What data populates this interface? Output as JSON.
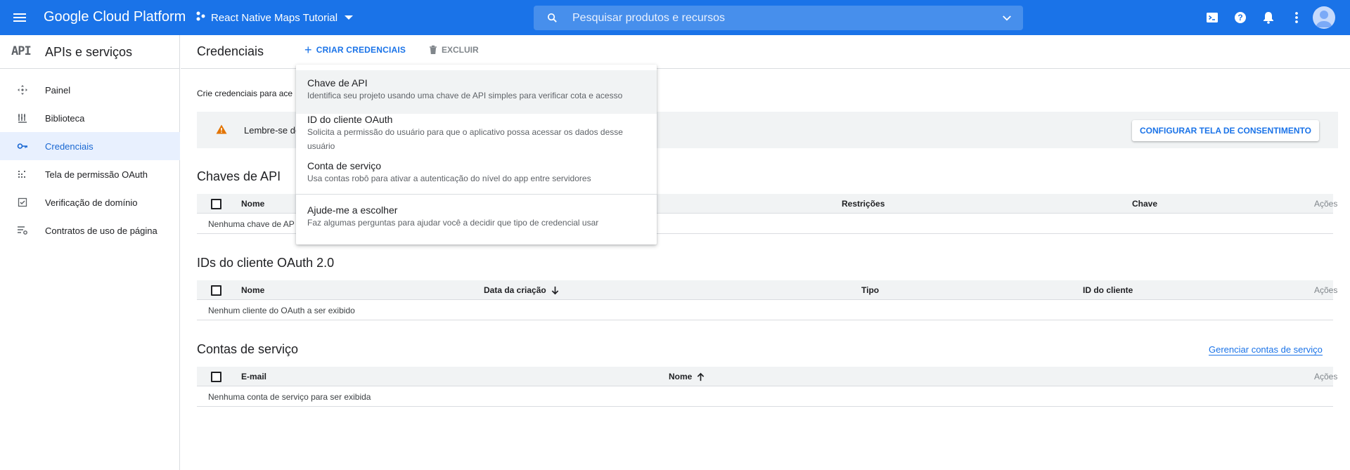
{
  "topbar": {
    "brand": "Google Cloud Platform",
    "project": "React Native Maps Tutorial",
    "search_placeholder": "Pesquisar produtos e recursos",
    "icons": [
      "menu-icon",
      "project-icon",
      "search-icon",
      "chevron-down-icon",
      "cloud-shell-icon",
      "help-icon",
      "notifications-icon",
      "more-vert-icon",
      "avatar"
    ]
  },
  "sidebar": {
    "logo": "API",
    "title": "APIs e serviços",
    "items": [
      {
        "label": "Painel",
        "icon": "dashboard-icon",
        "active": false
      },
      {
        "label": "Biblioteca",
        "icon": "library-icon",
        "active": false
      },
      {
        "label": "Credenciais",
        "icon": "key-icon",
        "active": true
      },
      {
        "label": "Tela de permissão OAuth",
        "icon": "consent-icon",
        "active": false
      },
      {
        "label": "Verificação de domínio",
        "icon": "domain-check-icon",
        "active": false
      },
      {
        "label": "Contratos de uso de página",
        "icon": "page-settings-icon",
        "active": false
      }
    ]
  },
  "header": {
    "title": "Credenciais",
    "create_label": "CRIAR CREDENCIAIS",
    "delete_label": "EXCLUIR"
  },
  "intro_text": "Crie credenciais para ace",
  "banner": {
    "text": "Lembre-se de",
    "button_label": "CONFIGURAR TELA DE CONSENTIMENTO"
  },
  "api_keys": {
    "title": "Chaves de API",
    "columns": [
      "Nome",
      "Restrições",
      "Chave",
      "Ações"
    ],
    "empty": "Nenhuma chave de AP"
  },
  "oauth": {
    "title": "IDs do cliente OAuth 2.0",
    "columns": [
      "Nome",
      "Data da criação",
      "Tipo",
      "ID do cliente",
      "Ações"
    ],
    "empty": "Nenhum cliente do OAuth a ser exibido"
  },
  "service_accounts": {
    "title": "Contas de serviço",
    "manage_link": "Gerenciar contas de serviço",
    "columns": [
      "E-mail",
      "Nome",
      "Ações"
    ],
    "empty": "Nenhuma conta de serviço para ser exibida"
  },
  "menu": {
    "items": [
      {
        "title": "Chave de API",
        "desc": "Identifica seu projeto usando uma chave de API simples para verificar cota e acesso"
      },
      {
        "title": "ID do cliente OAuth",
        "desc": "Solicita a permissão do usuário para que o aplicativo possa acessar os dados desse usuário"
      },
      {
        "title": "Conta de serviço",
        "desc": "Usa contas robô para ativar a autenticação do nível do app entre servidores"
      },
      {
        "title": "Ajude-me a escolher",
        "desc": "Faz algumas perguntas para ajudar você a decidir que tipo de credencial usar"
      }
    ]
  },
  "colors": {
    "topbar": "#1a73e8",
    "accent": "#1a73e8",
    "active_bg": "#e8f0fe",
    "warning": "#e37400"
  }
}
